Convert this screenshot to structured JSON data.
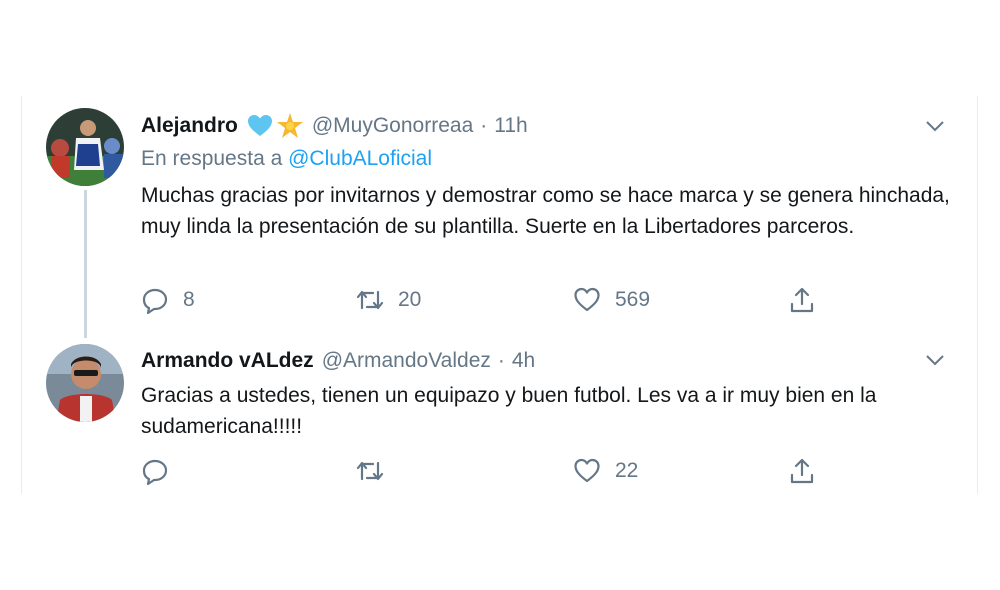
{
  "tweets": [
    {
      "name": "Alejandro",
      "handle": "@MuyGonorreaa",
      "separator": "·",
      "time": "11h",
      "badges": [
        "blue-heart-icon",
        "star-icon"
      ],
      "reply_prefix": "En respuesta a",
      "reply_to": "@ClubALoficial",
      "text": "Muchas gracias por invitarnos y demostrar como se hace marca y se genera hinchada, muy linda la presentación de su plantilla. Suerte en la Libertadores parceros.",
      "replies": "8",
      "retweets": "20",
      "likes": "569"
    },
    {
      "name": "Armando vALdez",
      "handle": "@ArmandoValdez",
      "separator": "·",
      "time": "4h",
      "text": "Gracias a ustedes, tienen un equipazo y buen futbol. Les va a ir muy bien en la sudamericana!!!!!",
      "replies": "",
      "retweets": "",
      "likes": "22"
    }
  ],
  "colors": {
    "text": "#14171a",
    "secondary": "#657786",
    "link": "#1da1f2",
    "heart_badge": "#5ec4f0",
    "star_badge": "#f7b731",
    "divider": "#e6ecf0",
    "thread_line": "#ccd6dd"
  }
}
